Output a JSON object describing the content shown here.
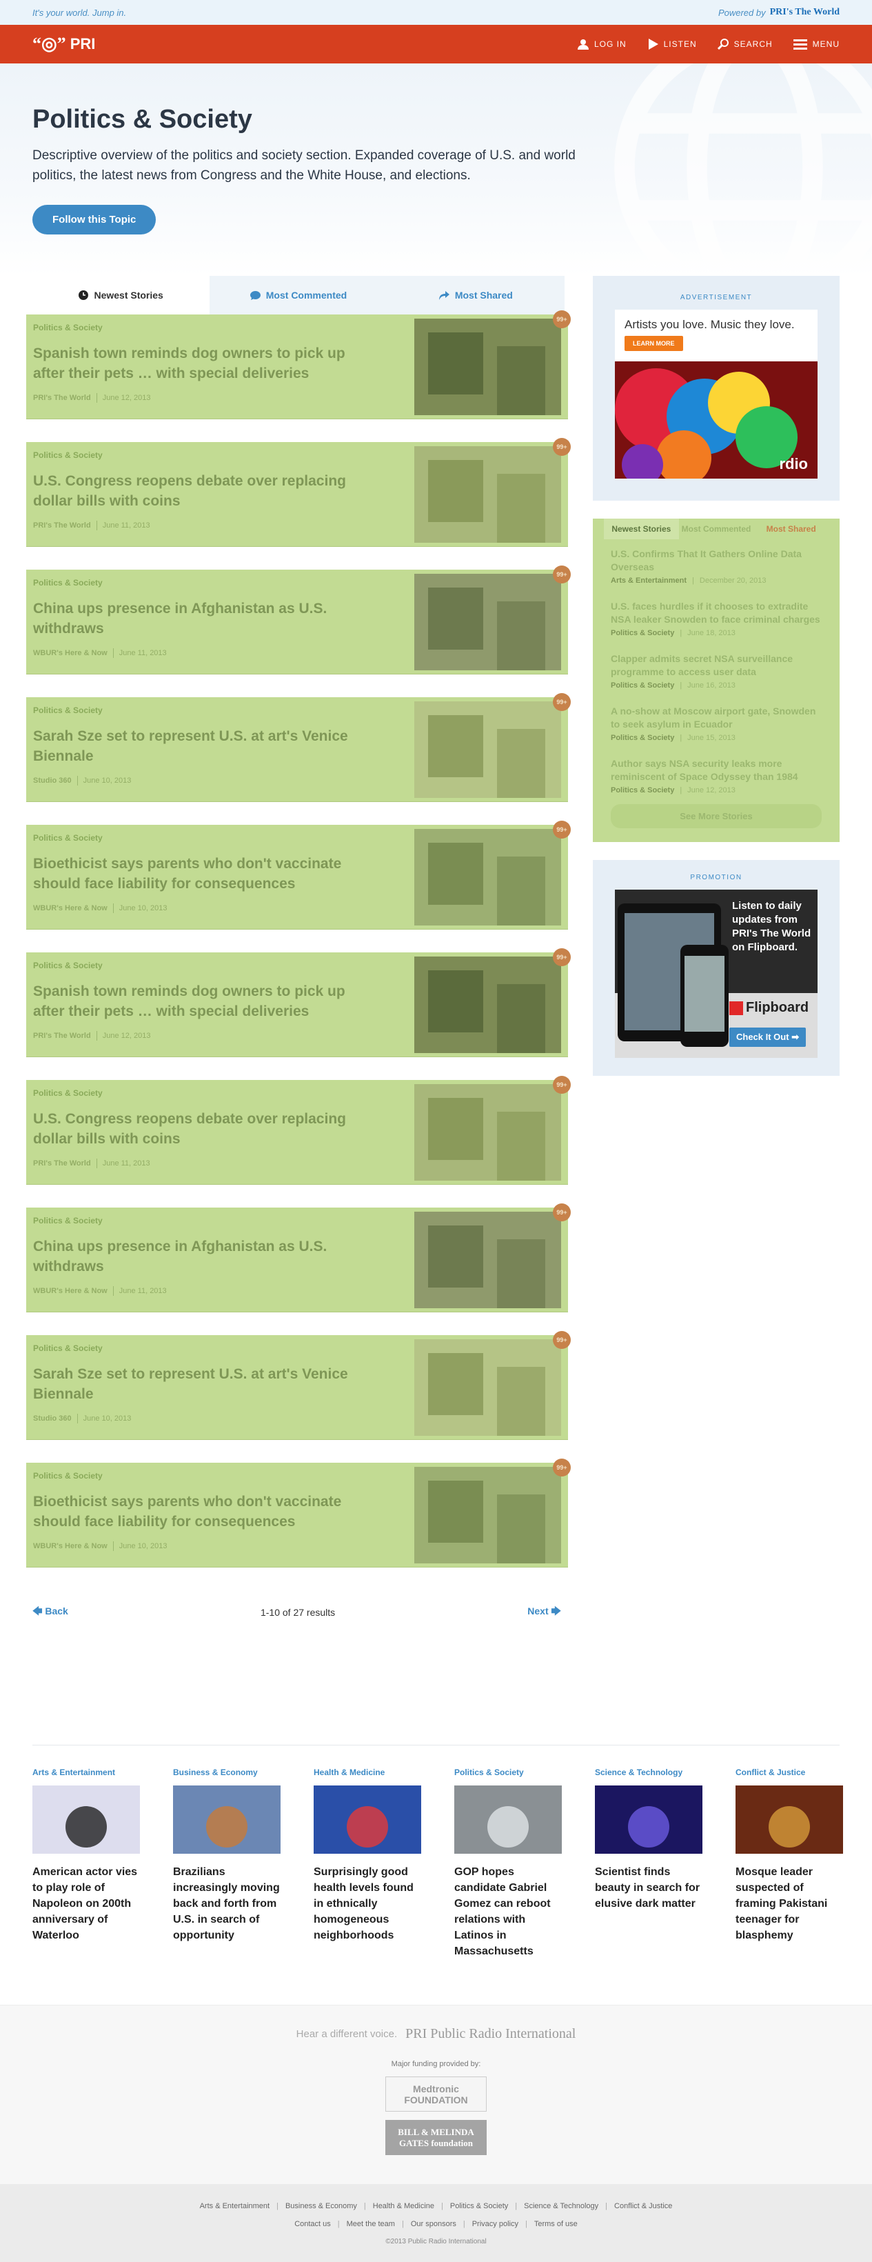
{
  "topbar": {
    "tagline": "It's your world. Jump in.",
    "powered": "Powered by",
    "brand": "PRI's The World"
  },
  "nav": {
    "logo": "PRI",
    "items": [
      {
        "label": "LOG IN",
        "icon": "user-icon"
      },
      {
        "label": "LISTEN",
        "icon": "play-icon"
      },
      {
        "label": "SEARCH",
        "icon": "search-icon"
      },
      {
        "label": "MENU",
        "icon": "menu-icon"
      }
    ]
  },
  "hero": {
    "title": "Politics & Society",
    "description": "Descriptive overview of the politics and society section. Expanded coverage of U.S. and world politics, the latest news from Congress and the White House, and elections.",
    "follow": "Follow this Topic"
  },
  "tabs": [
    {
      "label": "Newest Stories",
      "icon": "clock-icon"
    },
    {
      "label": "Most Commented",
      "icon": "comment-icon"
    },
    {
      "label": "Most Shared",
      "icon": "share-icon"
    }
  ],
  "stories": [
    {
      "section": "Politics & Society",
      "title": "Spanish town reminds dog owners to pick up after their pets … with special deliveries",
      "source": "PRI's The World",
      "date": "June 12, 2013",
      "badge": "99+"
    },
    {
      "section": "Politics & Society",
      "title": "U.S. Congress reopens debate over replacing dollar bills with coins",
      "source": "PRI's The World",
      "date": "June 11, 2013",
      "badge": "99+"
    },
    {
      "section": "Politics & Society",
      "title": "China ups presence in Afghanistan as U.S. withdraws",
      "source": "WBUR's Here & Now",
      "date": "June 11, 2013",
      "badge": "99+"
    },
    {
      "section": "Politics & Society",
      "title": "Sarah Sze set to represent U.S. at art's Venice Biennale",
      "source": "Studio 360",
      "date": "June 10, 2013",
      "badge": "99+"
    },
    {
      "section": "Politics & Society",
      "title": "Bioethicist says parents who don't vaccinate should face liability for consequences",
      "source": "WBUR's Here & Now",
      "date": "June 10, 2013",
      "badge": "99+"
    },
    {
      "section": "Politics & Society",
      "title": "Spanish town reminds dog owners to pick up after their pets … with special deliveries",
      "source": "PRI's The World",
      "date": "June 12, 2013",
      "badge": "99+"
    },
    {
      "section": "Politics & Society",
      "title": "U.S. Congress reopens debate over replacing dollar bills with coins",
      "source": "PRI's The World",
      "date": "June 11, 2013",
      "badge": "99+"
    },
    {
      "section": "Politics & Society",
      "title": "China ups presence in Afghanistan as U.S. withdraws",
      "source": "WBUR's Here & Now",
      "date": "June 11, 2013",
      "badge": "99+"
    },
    {
      "section": "Politics & Society",
      "title": "Sarah Sze set to represent U.S. at art's Venice Biennale",
      "source": "Studio 360",
      "date": "June 10, 2013",
      "badge": "99+"
    },
    {
      "section": "Politics & Society",
      "title": "Bioethicist says parents who don't vaccinate should face liability for consequences",
      "source": "WBUR's Here & Now",
      "date": "June 10, 2013",
      "badge": "99+"
    }
  ],
  "pager": {
    "back": "Back",
    "results": "1-10 of 27 results",
    "next": "Next"
  },
  "ad": {
    "label": "ADVERTISEMENT",
    "headline": "Artists you love. Music they love.",
    "button": "LEARN MORE",
    "brand": "rdio"
  },
  "popular": {
    "tabs": [
      "Newest Stories",
      "Most Commented",
      "Most Shared"
    ],
    "items": [
      {
        "title": "U.S. Confirms That It Gathers Online Data Overseas",
        "section": "Arts & Entertainment",
        "date": "December 20, 2013"
      },
      {
        "title": "U.S. faces hurdles if it chooses to extradite NSA leaker Snowden to face criminal charges",
        "section": "Politics & Society",
        "date": "June 18, 2013"
      },
      {
        "title": "Clapper admits secret NSA surveillance programme to access user data",
        "section": "Politics & Society",
        "date": "June 16, 2013"
      },
      {
        "title": "A no-show at Moscow airport gate, Snowden to seek asylum in Ecuador",
        "section": "Politics & Society",
        "date": "June 15, 2013"
      },
      {
        "title": "Author says NSA security leaks more reminiscent of Space Odyssey than 1984",
        "section": "Politics & Society",
        "date": "June 12, 2013"
      }
    ],
    "see_more": "See More Stories"
  },
  "promo": {
    "label": "PROMOTION",
    "text": "Listen to daily updates from PRI's The World on Flipboard.",
    "brand": "Flipboard",
    "cta": "Check It Out"
  },
  "categories": [
    {
      "label": "Arts & Entertainment",
      "title": "American actor vies to play role of Napoleon on 200th anniversary of Waterloo"
    },
    {
      "label": "Business & Economy",
      "title": "Brazilians increasingly moving back and forth from U.S. in search of opportunity"
    },
    {
      "label": "Health & Medicine",
      "title": "Surprisingly good health levels found in ethnically homogeneous neighborhoods"
    },
    {
      "label": "Politics & Society",
      "title": "GOP hopes candidate Gabriel Gomez can reboot relations with Latinos in Massachusetts"
    },
    {
      "label": "Science & Technology",
      "title": "Scientist finds beauty in search for elusive dark matter"
    },
    {
      "label": "Conflict & Justice",
      "title": "Mosque leader suspected of framing Pakistani teenager for blasphemy"
    }
  ],
  "footer": {
    "hear": "Hear a different voice.",
    "pri_full": "PRI Public Radio International",
    "funding": "Major funding provided by:",
    "sponsors": [
      "Medtronic FOUNDATION",
      "BILL & MELINDA GATES foundation"
    ],
    "links": [
      "Arts & Entertainment",
      "Business & Economy",
      "Health & Medicine",
      "Politics & Society",
      "Science & Technology",
      "Conflict & Justice"
    ],
    "links2": [
      "Contact us",
      "Meet the team",
      "Our sponsors",
      "Privacy policy",
      "Terms of use"
    ],
    "copyright": "©2013 Public Radio International"
  }
}
